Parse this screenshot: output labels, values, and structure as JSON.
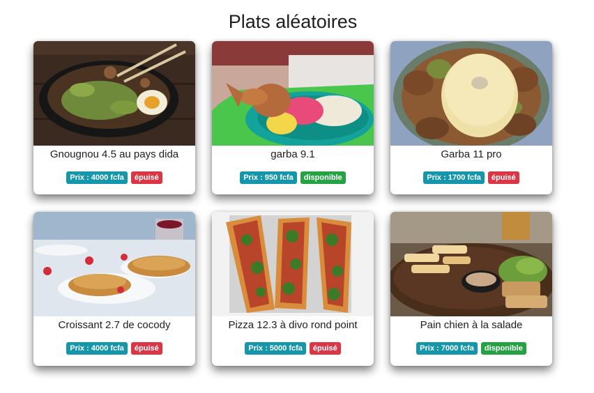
{
  "page": {
    "title": "Plats aléatoires"
  },
  "dishes": [
    {
      "name": "Gnougnou 4.5 au pays dida",
      "price": "Prix : 4000 fcfa",
      "status": "épuisé",
      "status_type": "sold-out",
      "image": "ramen-bowl-photo"
    },
    {
      "name": "garba 9.1",
      "price": "Prix : 950 fcfa",
      "status": "disponible",
      "status_type": "available",
      "image": "fried-fish-salad-photo"
    },
    {
      "name": "Garba 11 pro",
      "price": "Prix : 1700 fcfa",
      "status": "épuisé",
      "status_type": "sold-out",
      "image": "attieke-dome-photo"
    },
    {
      "name": "Croissant 2.7 de cocody",
      "price": "Prix : 4000 fcfa",
      "status": "épuisé",
      "status_type": "sold-out",
      "image": "croissant-table-photo"
    },
    {
      "name": "Pizza 12.3 à divo rond point",
      "price": "Prix : 5000 fcfa",
      "status": "épuisé",
      "status_type": "sold-out",
      "image": "arugula-pizza-photo"
    },
    {
      "name": "Pain chien à la salade",
      "price": "Prix : 7000 fcfa",
      "status": "disponible",
      "status_type": "available",
      "image": "grilled-platter-photo"
    }
  ],
  "colors": {
    "price_badge": "#1596aa",
    "sold_out_badge": "#d93646",
    "available_badge": "#25a244"
  }
}
